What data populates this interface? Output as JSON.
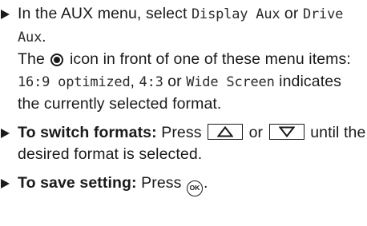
{
  "instructions": {
    "step1": {
      "text_before": "In the AUX menu, select ",
      "option_display": "Display Aux",
      "text_or": " or ",
      "option_drive": "Drive Aux",
      "text_end": ".",
      "note_prefix": "The ",
      "note_icon": "radio-selected-icon",
      "note_mid": " icon in front of one of these menu items: ",
      "format_1": "16:9 optimized",
      "comma_1": ", ",
      "format_2": "4:3",
      "text_or2": " or ",
      "format_3": "Wide Screen",
      "note_end": " indicates the currently selected format."
    },
    "step2": {
      "label": "To switch formats:",
      "text_press": " Press ",
      "up_key_icon": "triangle-up-icon",
      "text_or": " or ",
      "down_key_icon": "triangle-down-icon",
      "text_end": " until the desired format is selected."
    },
    "step3": {
      "label": "To save setting:",
      "text_press": " Press ",
      "ok_label": "OK",
      "text_end": "."
    }
  }
}
